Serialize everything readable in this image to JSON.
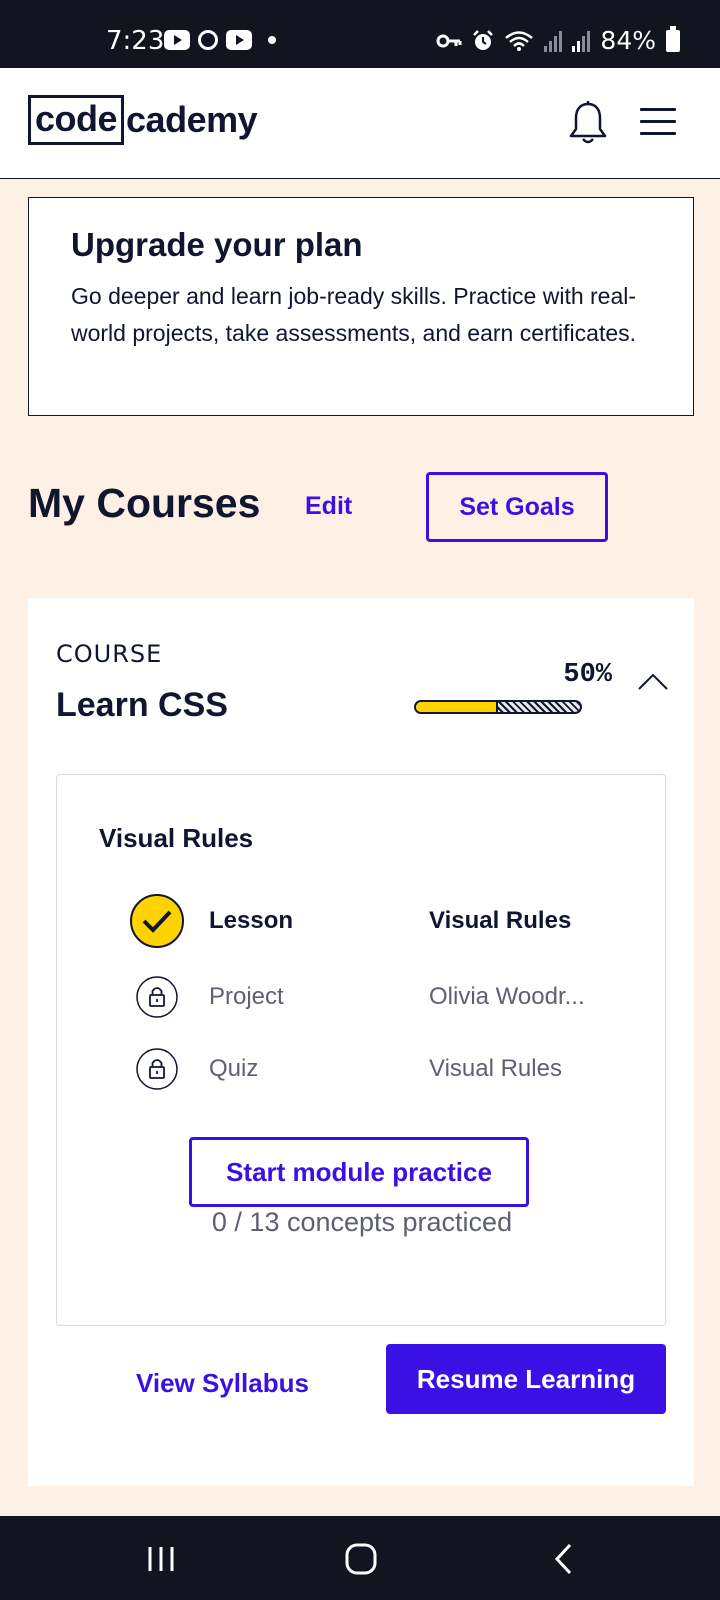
{
  "status_bar": {
    "time": "7:23",
    "battery": "84%",
    "icons": [
      "youtube-icon",
      "settings-icon",
      "youtube-icon",
      "dot-icon",
      "vpn-key-icon",
      "alarm-icon",
      "wifi-icon",
      "signal-icon",
      "signal-icon",
      "battery-icon"
    ]
  },
  "header": {
    "logo_boxed": "code",
    "logo_rest": "cademy",
    "icons": [
      "bell-icon",
      "menu-icon"
    ]
  },
  "upgrade": {
    "title": "Upgrade your plan",
    "body": "Go deeper and learn job-ready skills. Practice with real-world projects, take assessments, and earn certificates."
  },
  "my_courses": {
    "title": "My Courses",
    "edit_label": "Edit",
    "set_goals_label": "Set Goals"
  },
  "course": {
    "kicker": "COURSE",
    "title": "Learn CSS",
    "progress_label": "50%",
    "progress": 0.5,
    "module": {
      "title": "Visual Rules",
      "items": [
        {
          "type": "Lesson",
          "name": "Visual Rules",
          "status": "complete"
        },
        {
          "type": "Project",
          "name": "Olivia Woodr...",
          "status": "locked"
        },
        {
          "type": "Quiz",
          "name": "Visual Rules",
          "status": "locked"
        }
      ],
      "practice_label": "Start module practice",
      "practice_status": "0 / 13 concepts practiced"
    },
    "view_syllabus_label": "View Syllabus",
    "resume_label": "Resume Learning"
  },
  "colors": {
    "accent": "#3a10e5",
    "background": "#fff0e6",
    "navy": "#10162f",
    "yellow": "#ffd300"
  }
}
